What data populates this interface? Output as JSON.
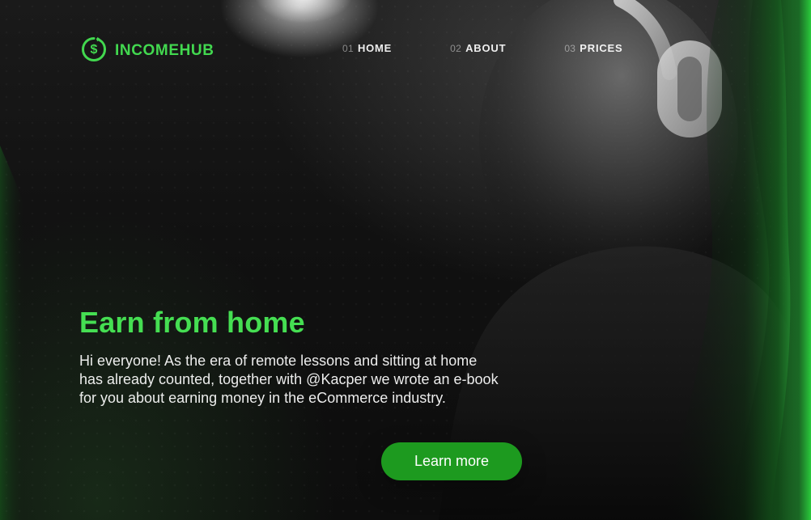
{
  "brand": {
    "name": "INCOMEHUB",
    "icon": "dollar-refresh-icon"
  },
  "nav": {
    "items": [
      {
        "num": "01",
        "label": "HOME"
      },
      {
        "num": "02",
        "label": "ABOUT"
      },
      {
        "num": "03",
        "label": "PRICES"
      }
    ]
  },
  "hero": {
    "title": "Earn from home",
    "description_lines": [
      "Hi everyone! As the era of remote lessons and sitting at home",
      "has already counted, together with @Kacper we wrote an e-book",
      "for you about earning money in the eCommerce industry."
    ],
    "cta_label": "Learn more"
  },
  "colors": {
    "accent_green": "#45DE52",
    "button_green": "#1D9A1F",
    "background": "#0E0E0E"
  }
}
